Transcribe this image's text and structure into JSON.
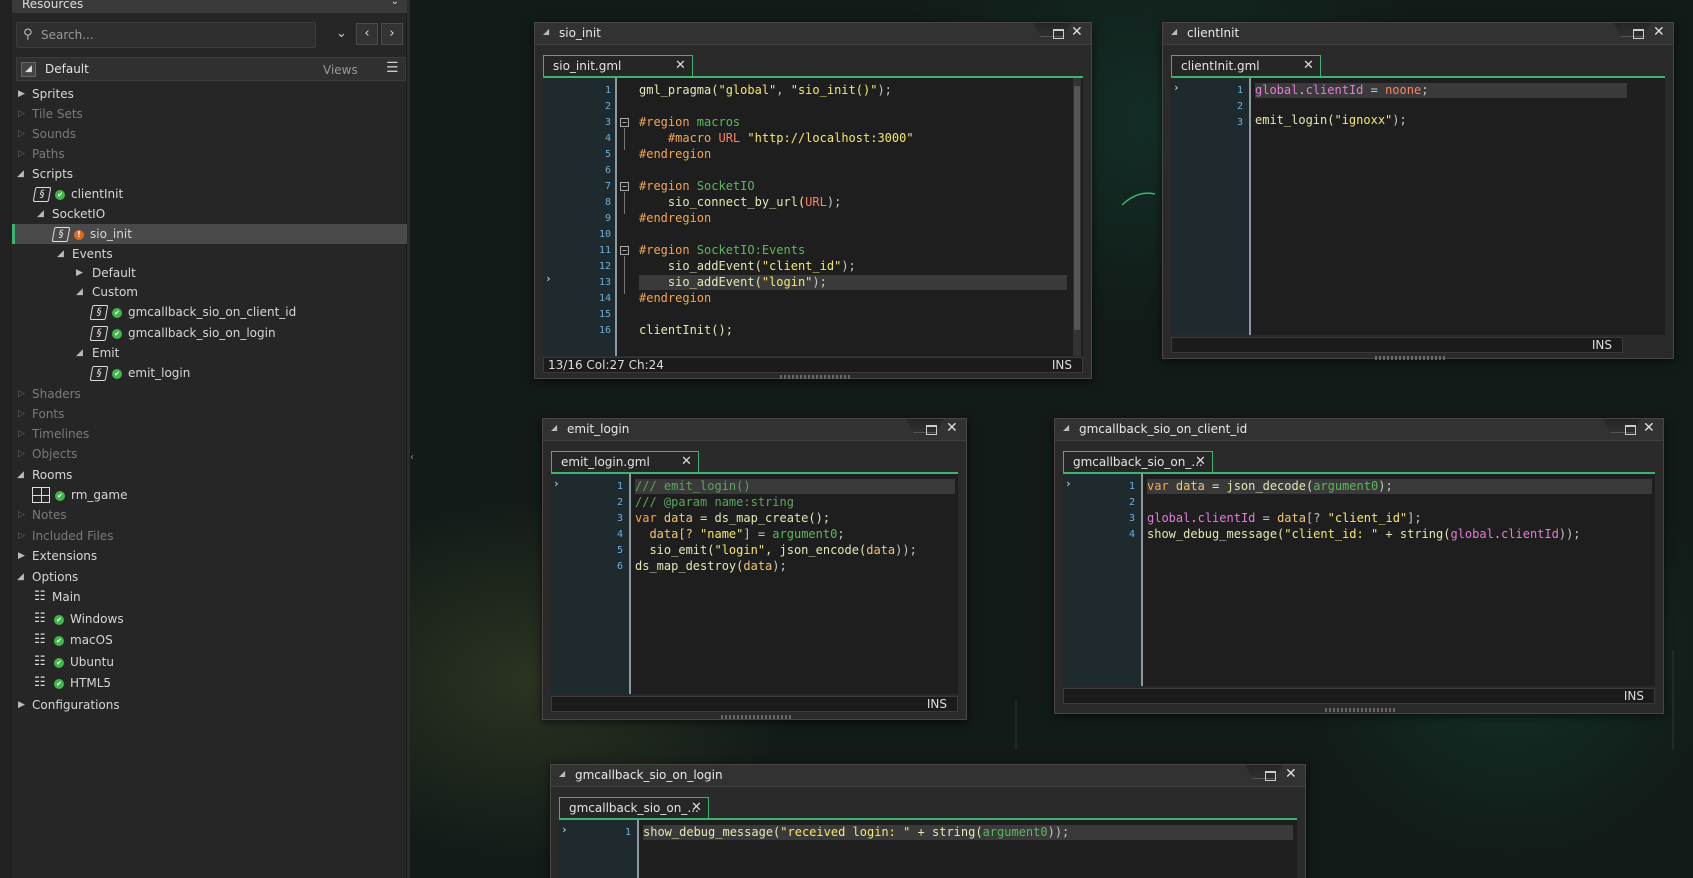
{
  "sidebar": {
    "header_title": "Resources",
    "search_placeholder": "Search...",
    "views": {
      "default_label": "Default",
      "views_label": "Views"
    },
    "tree": {
      "sprites": "Sprites",
      "tile_sets": "Tile Sets",
      "sounds": "Sounds",
      "paths": "Paths",
      "scripts": "Scripts",
      "clientinit": "clientInit",
      "socketio": "SocketIO",
      "sio_init": "sio_init",
      "events": "Events",
      "default": "Default",
      "custom": "Custom",
      "cb_client_id": "gmcallback_sio_on_client_id",
      "cb_login": "gmcallback_sio_on_login",
      "emit": "Emit",
      "emit_login": "emit_login",
      "shaders": "Shaders",
      "fonts": "Fonts",
      "timelines": "Timelines",
      "objects": "Objects",
      "rooms": "Rooms",
      "rm_game": "rm_game",
      "notes": "Notes",
      "included_files": "Included Files",
      "extensions": "Extensions",
      "options": "Options",
      "main": "Main",
      "windows": "Windows",
      "macos": "macOS",
      "ubuntu": "Ubuntu",
      "html5": "HTML5",
      "configurations": "Configurations"
    }
  },
  "windows": {
    "sio_init": {
      "title": "sio_init",
      "tab": "sio_init.gml",
      "status": "13/16 Col:27 Ch:24",
      "mode": "INS",
      "lines": [
        "1",
        "2",
        "3",
        "4",
        "5",
        "6",
        "7",
        "8",
        "9",
        "10",
        "11",
        "12",
        "13",
        "14",
        "15",
        "16"
      ],
      "code": {
        "l1a": "gml_pragma(",
        "l1b": "\"global\"",
        "l1c": ", ",
        "l1d": "\"sio_init()\"",
        "l1e": ");",
        "l3a": "#region",
        "l3b": " macros",
        "l4a": "    #macro ",
        "l4b": "URL",
        "l4c": " \"http://localhost:3000\"",
        "l5": "#endregion",
        "l7a": "#region",
        "l7b": " SocketIO",
        "l8a": "    sio_connect_by_url(",
        "l8b": "URL",
        "l8c": ");",
        "l9": "#endregion",
        "l11a": "#region",
        "l11b": " SocketIO:Events",
        "l12a": "    sio_addEvent(",
        "l12b": "\"client_id\"",
        "l12c": ");",
        "l13a": "    sio_addEvent(",
        "l13b": "\"login\"",
        "l13c": ");",
        "l14": "#endregion",
        "l16": "clientInit();"
      }
    },
    "clientinit": {
      "title": "clientInit",
      "tab": "clientInit.gml",
      "mode": "INS",
      "lines": [
        "1",
        "2",
        "3"
      ],
      "code": {
        "l1a": "global",
        "l1b": ".",
        "l1c": "clientId",
        "l1d": " = ",
        "l1e": "noone",
        "l1f": ";",
        "l3a": "emit_login(",
        "l3b": "\"ignoxx\"",
        "l3c": ");"
      }
    },
    "emit_login": {
      "title": "emit_login",
      "tab": "emit_login.gml",
      "mode": "INS",
      "lines": [
        "1",
        "2",
        "3",
        "4",
        "5",
        "6"
      ],
      "code": {
        "l1": "/// emit_login()",
        "l2": "/// @param name:string",
        "l3a": "var",
        "l3b": " data",
        "l3c": " = ds_map_create();",
        "l4a": "  data[? ",
        "l4b": "\"name\"",
        "l4c": "] = ",
        "l4d": "argument0",
        "l4e": ";",
        "l5a": "  sio_emit(",
        "l5b": "\"login\"",
        "l5c": ", json_encode(",
        "l5d": "data",
        "l5e": "));",
        "l6a": "ds_map_destroy(",
        "l6b": "data",
        "l6c": ");"
      }
    },
    "cb_client_id": {
      "title": "gmcallback_sio_on_client_id",
      "tab": "gmcallback_sio_on_...",
      "mode": "INS",
      "lines": [
        "1",
        "2",
        "3",
        "4"
      ],
      "code": {
        "l1a": "var",
        "l1b": " data",
        "l1c": " = json_decode(",
        "l1d": "argument0",
        "l1e": ");",
        "l3a": "global",
        "l3b": ".",
        "l3c": "clientId",
        "l3d": " = ",
        "l3e": "data",
        "l3f": "[? ",
        "l3g": "\"client_id\"",
        "l3h": "];",
        "l4a": "show_debug_message(",
        "l4b": "\"client_id: \"",
        "l4c": " + string(",
        "l4d": "global",
        "l4e": ".",
        "l4f": "clientId",
        "l4g": "));"
      }
    },
    "cb_login": {
      "title": "gmcallback_sio_on_login",
      "tab": "gmcallback_sio_on_...",
      "lines": [
        "1"
      ],
      "code": {
        "l1a": "show_debug_message(",
        "l1b": "\"received login: \"",
        "l1c": " + string(",
        "l1d": "argument0",
        "l1e": "));"
      }
    }
  },
  "colors": {
    "accent": "#3cb371",
    "ok": "#41b64a",
    "warn": "#e06a1e"
  }
}
